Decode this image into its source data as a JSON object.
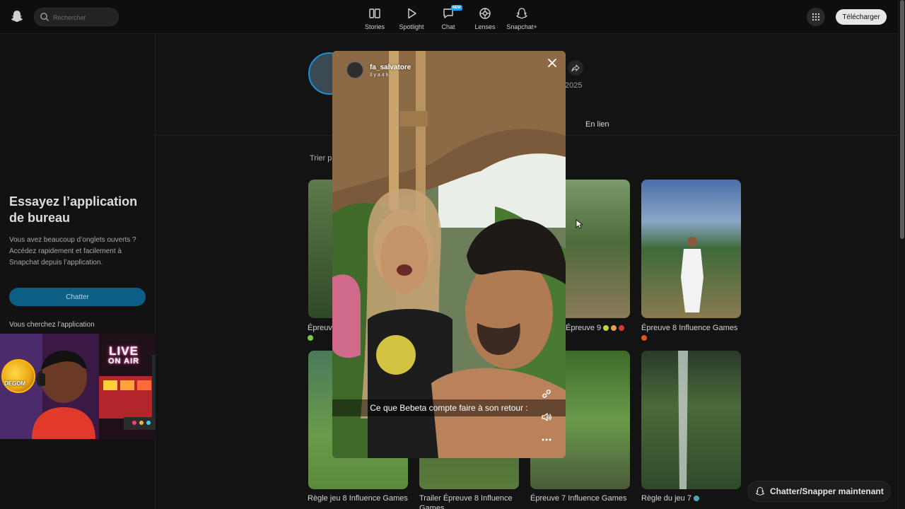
{
  "topbar": {
    "search_placeholder": "Rechercher",
    "nav": [
      {
        "label": "Stories"
      },
      {
        "label": "Spotlight"
      },
      {
        "label": "Chat",
        "badge": "NEW"
      },
      {
        "label": "Lenses"
      },
      {
        "label": "Snapchat+"
      }
    ],
    "download_label": "Télécharger"
  },
  "sidebar": {
    "promo_title": "Essayez l’application de bureau",
    "promo_text": "Vous avez beaucoup d’onglets ouverts ? Accédez rapidement et facilement à Snapchat depuis l’application.",
    "chat_button": "Chatter",
    "looking_text": "Vous cherchez l’application"
  },
  "webcam": {
    "live_line1": "LIVE",
    "live_line2": "ON AIR",
    "badge_text": "DEGOM"
  },
  "profile": {
    "year": "2025",
    "tab_link": "En lien",
    "sort_label": "Trier p"
  },
  "tiles": [
    {
      "caption": "Épreuve"
    },
    {
      "caption": "Épreuve 9"
    },
    {
      "caption": "Épreuve 8 Influence Games"
    },
    {
      "caption": "Règle jeu 8 Influence Games"
    },
    {
      "caption": "Trailer Épreuve 8 Influence Games"
    },
    {
      "caption": "Épreuve 7 Influence Games"
    },
    {
      "caption": "Règle du jeu 7"
    }
  ],
  "story": {
    "username": "fa_salvatore",
    "time": "Il y a 4 h",
    "caption": "Ce que Bebeta compte faire à son retour :"
  },
  "snap_now": "Chatter/Snapper maintenant",
  "colors": {
    "accent_blue": "#0c5e84",
    "brand_yellow": "#fffc00",
    "badge_blue": "#1da1f2"
  }
}
